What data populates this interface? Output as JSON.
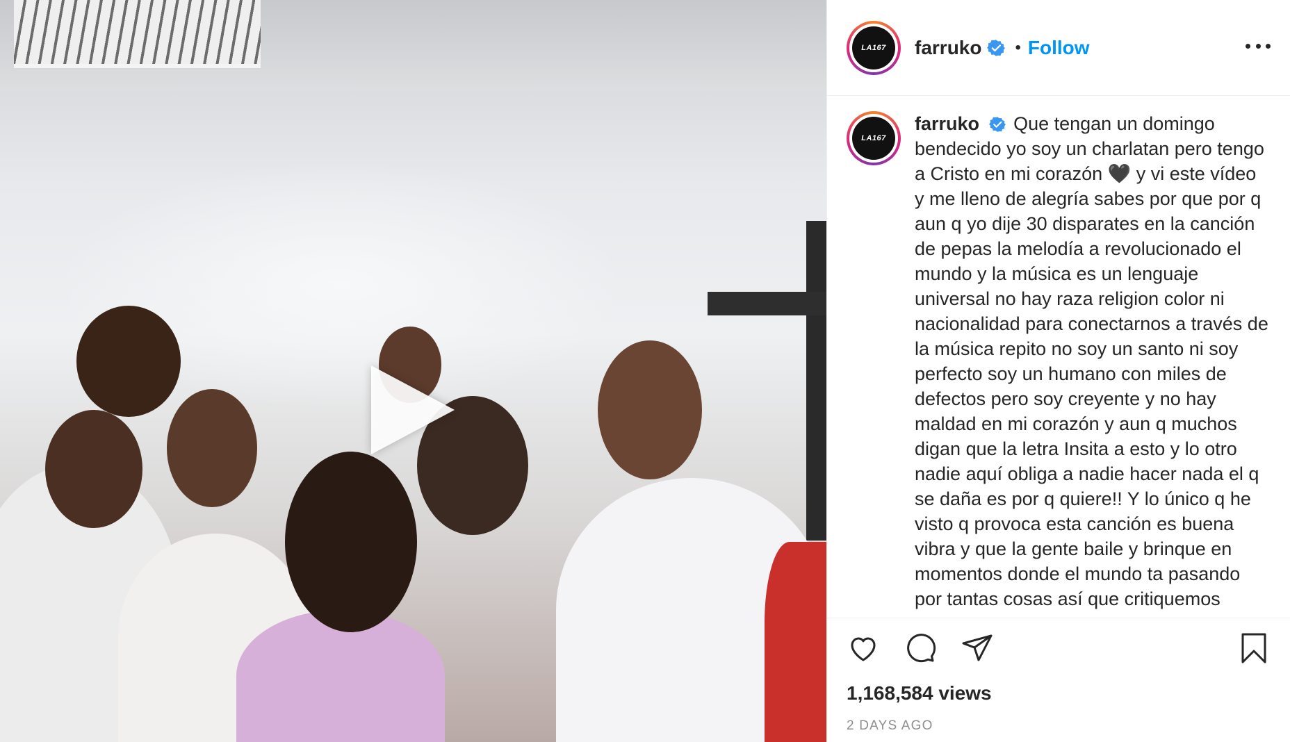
{
  "post": {
    "username": "farruko",
    "verified": true,
    "follow_label": "Follow",
    "avatar_text": "LA167",
    "caption": "Que tengan un domingo bendecido yo soy un charlatan pero tengo a Cristo en mi corazón 🖤 y vi este vídeo y me lleno de alegría sabes por que por q aun q yo dije 30 disparates en la canción de pepas la melodía a revolucionado el mundo y la música es un lenguaje universal no hay raza religion color ni nacionalidad para conectarnos a través de la música repito no soy un santo ni soy perfecto soy un humano con miles de defectos pero soy creyente y no hay maldad en mi corazón y aun q muchos digan que la letra Insita a esto y lo otro nadie aquí obliga a nadie hacer nada el q se daña es por q quiere!! Y lo único q he visto q provoca esta canción es buena vibra y que la gente baile y brinque en momentos donde el mundo ta pasando por tantas cosas así que critiquemos",
    "views": "1,168,584 views",
    "timestamp": "2 DAYS AGO"
  },
  "icons": {
    "play": "play-icon",
    "more": "more-options-icon",
    "like": "heart-icon",
    "comment": "comment-icon",
    "share": "paper-plane-icon",
    "save": "bookmark-icon",
    "verified": "verified-badge-icon"
  },
  "colors": {
    "link_blue": "#0095f6",
    "text": "#262626",
    "muted": "#8e8e8e",
    "verified_blue": "#3897f0"
  }
}
